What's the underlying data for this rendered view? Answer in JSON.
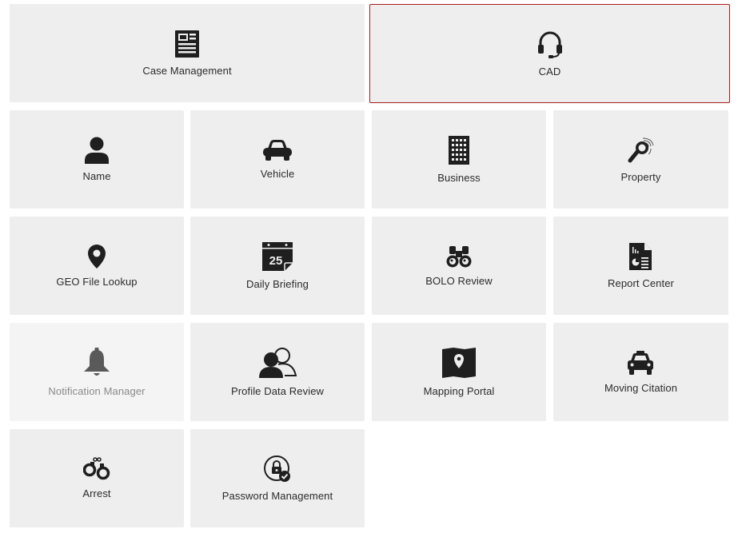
{
  "tiles": [
    {
      "label": "Case Management",
      "icon": "document-icon",
      "state": "normal"
    },
    {
      "label": "CAD",
      "icon": "headset-icon",
      "state": "selected",
      "border_color": "#a61c1c"
    },
    {
      "label": "Name",
      "icon": "person-icon",
      "state": "normal"
    },
    {
      "label": "Vehicle",
      "icon": "car-icon",
      "state": "normal"
    },
    {
      "label": "Business",
      "icon": "building-icon",
      "state": "normal"
    },
    {
      "label": "Property",
      "icon": "fingerprint-search-icon",
      "state": "normal"
    },
    {
      "label": "GEO File Lookup",
      "icon": "map-pin-icon",
      "state": "normal"
    },
    {
      "label": "Daily Briefing",
      "icon": "calendar-icon",
      "state": "normal",
      "icon_text": "25"
    },
    {
      "label": "BOLO Review",
      "icon": "binoculars-icon",
      "state": "normal"
    },
    {
      "label": "Report Center",
      "icon": "report-icon",
      "state": "normal"
    },
    {
      "label": "Notification Manager",
      "icon": "bell-icon",
      "state": "disabled"
    },
    {
      "label": "Profile Data Review",
      "icon": "users-icon",
      "state": "normal"
    },
    {
      "label": "Mapping Portal",
      "icon": "map-icon",
      "state": "normal"
    },
    {
      "label": "Moving Citation",
      "icon": "police-car-icon",
      "state": "normal"
    },
    {
      "label": "Arrest",
      "icon": "handcuffs-icon",
      "state": "normal"
    },
    {
      "label": "Password Management",
      "icon": "lock-check-icon",
      "state": "normal"
    }
  ],
  "colors": {
    "tile_background": "#eeeeee",
    "selected_border": "#a61c1c",
    "icon": "#1f1f1f",
    "label": "#2b2b2b",
    "disabled_label": "#8a8a8a"
  }
}
